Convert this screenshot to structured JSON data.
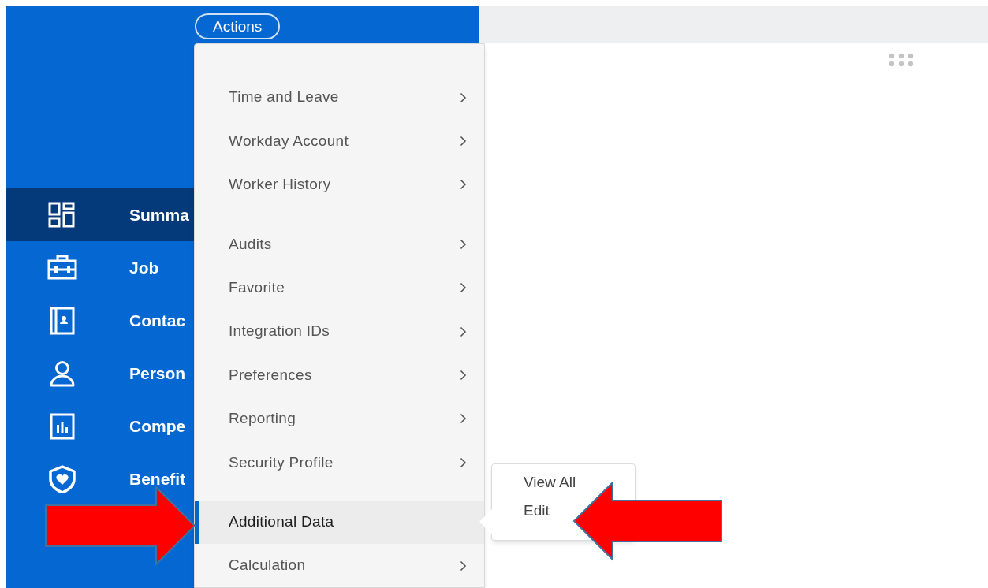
{
  "actions_button": "Actions",
  "sidebar": {
    "items": [
      {
        "label": "Summa",
        "selected": true
      },
      {
        "label": "Job",
        "selected": false
      },
      {
        "label": "Contac",
        "selected": false
      },
      {
        "label": "Person",
        "selected": false
      },
      {
        "label": "Compe",
        "selected": false
      },
      {
        "label": "Benefit",
        "selected": false
      }
    ]
  },
  "menu": {
    "groups": [
      [
        {
          "label": "Time and Leave",
          "selected": false,
          "has_submenu": true
        },
        {
          "label": "Workday Account",
          "selected": false,
          "has_submenu": true
        },
        {
          "label": "Worker History",
          "selected": false,
          "has_submenu": true
        }
      ],
      [
        {
          "label": "Audits",
          "selected": false,
          "has_submenu": true
        },
        {
          "label": "Favorite",
          "selected": false,
          "has_submenu": true
        },
        {
          "label": "Integration IDs",
          "selected": false,
          "has_submenu": true
        },
        {
          "label": "Preferences",
          "selected": false,
          "has_submenu": true
        },
        {
          "label": "Reporting",
          "selected": false,
          "has_submenu": true
        },
        {
          "label": "Security Profile",
          "selected": false,
          "has_submenu": true
        }
      ],
      [
        {
          "label": "Additional Data",
          "selected": true,
          "has_submenu": false
        },
        {
          "label": "Calculation",
          "selected": false,
          "has_submenu": true
        }
      ]
    ]
  },
  "submenu": {
    "items": [
      "View All",
      "Edit"
    ]
  },
  "annotations": [
    {
      "kind": "right-arrow"
    },
    {
      "kind": "left-arrow"
    }
  ]
}
